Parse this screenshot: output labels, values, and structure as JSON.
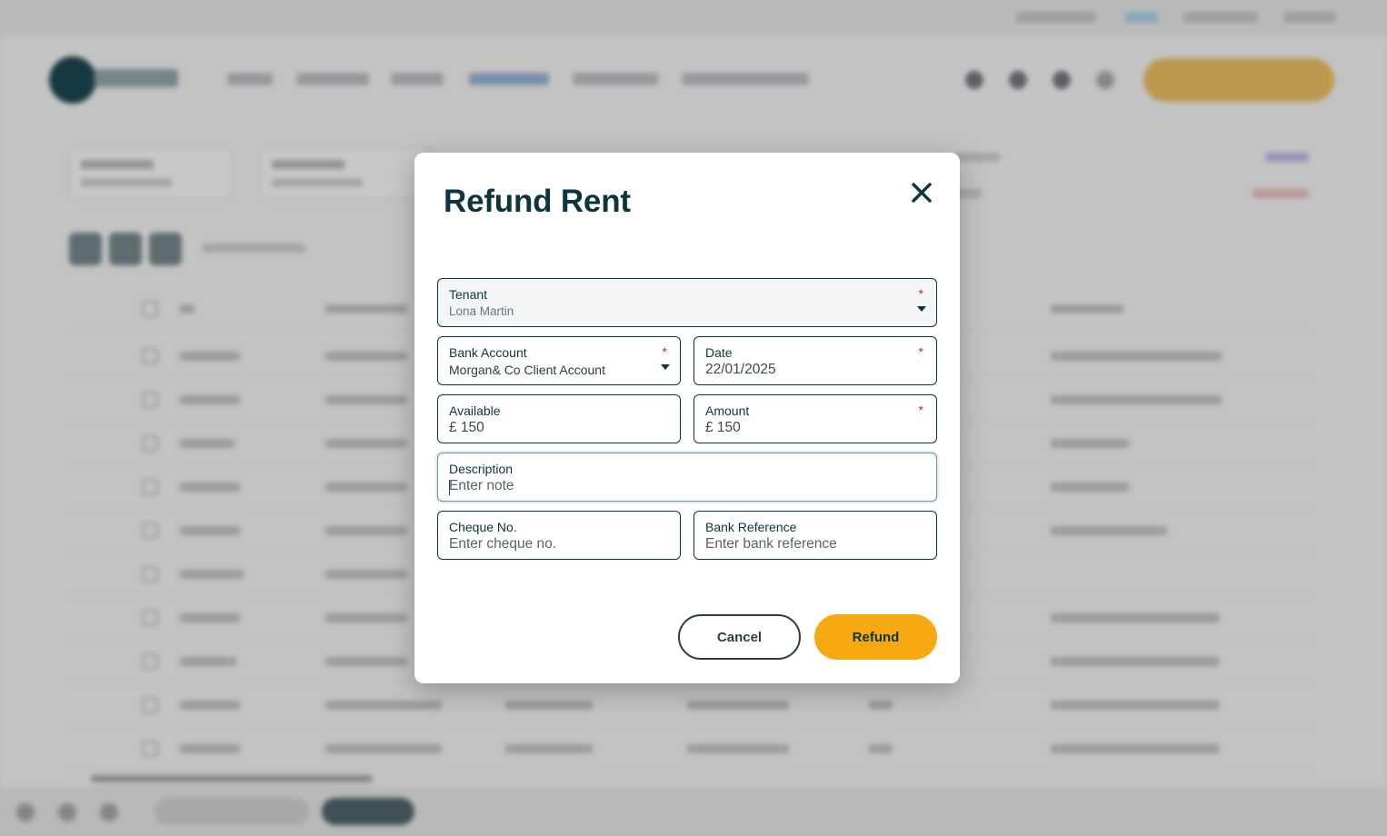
{
  "modal": {
    "title": "Refund Rent",
    "close_icon": "close-icon",
    "fields": {
      "tenant": {
        "label": "Tenant",
        "value": "Lona Martin",
        "required": true
      },
      "bank_account": {
        "label": "Bank Account",
        "value": "Morgan& Co Client Account",
        "required": true
      },
      "date": {
        "label": "Date",
        "value": "22/01/2025",
        "required": true
      },
      "available": {
        "label": "Available",
        "value": "£ 150"
      },
      "amount": {
        "label": "Amount",
        "value": "£ 150",
        "required": true
      },
      "description": {
        "label": "Description",
        "placeholder": "Enter note"
      },
      "cheque_no": {
        "label": "Cheque No.",
        "placeholder": "Enter cheque no."
      },
      "bank_reference": {
        "label": "Bank Reference",
        "placeholder": "Enter bank reference"
      }
    },
    "required_marker": "*",
    "buttons": {
      "cancel": "Cancel",
      "refund": "Refund"
    }
  },
  "colors": {
    "primary_dark": "#0e3440",
    "accent_orange": "#f7a911",
    "required_red": "#d22a2a"
  }
}
